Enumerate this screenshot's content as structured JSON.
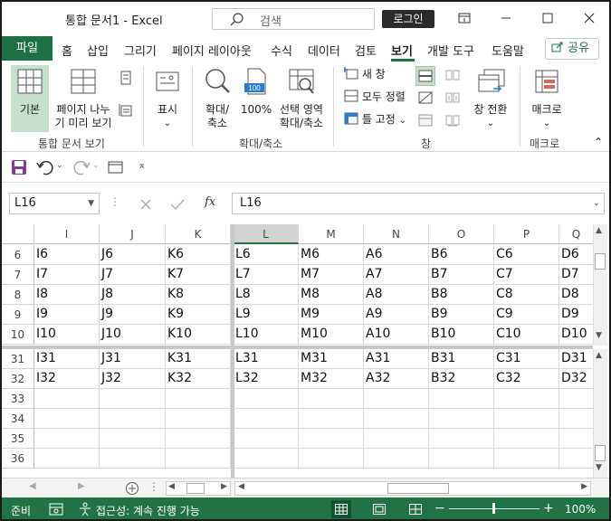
{
  "titlebar": {
    "title": "통합 문서1  -  Excel",
    "search_placeholder": "검색",
    "login_label": "로그인"
  },
  "tabs": {
    "file": "파일",
    "items": [
      "홈",
      "삽입",
      "그리기",
      "페이지 레이아웃",
      "수식",
      "데이터",
      "검토",
      "보기",
      "개발 도구",
      "도움말"
    ],
    "active": "보기",
    "share_label": "공유"
  },
  "ribbon": {
    "normal": "기본",
    "page_break_1": "페이지 나누",
    "page_break_2": "기 미리 보기",
    "group_views": "통합 문서 보기",
    "show": "표시",
    "zoom_1": "확대/",
    "zoom_2": "축소",
    "zoom100": "100%",
    "zoom100_icon": "100",
    "zoomsel_1": "선택 영역",
    "zoomsel_2": "확대/축소",
    "group_zoom": "확대/축소",
    "new_window": "새 창",
    "arrange_all": "모두 정렬",
    "freeze_panes": "틀 고정",
    "switch_windows": "창 전환",
    "group_window": "창",
    "macros": "매크로",
    "group_macros": "매크로"
  },
  "formula_bar": {
    "name_box": "L16",
    "content": "L16",
    "fx": "fx"
  },
  "grid": {
    "left_columns": [
      "I",
      "J",
      "K"
    ],
    "right_columns": [
      "L",
      "M",
      "N",
      "O",
      "P",
      "Q"
    ],
    "selected_column": "L",
    "top_rows": [
      {
        "row": "6",
        "cells": [
          "I6",
          "J6",
          "K6",
          "L6",
          "M6",
          "A6",
          "B6",
          "C6",
          "D6"
        ]
      },
      {
        "row": "7",
        "cells": [
          "I7",
          "J7",
          "K7",
          "L7",
          "M7",
          "A7",
          "B7",
          "C7",
          "D7"
        ]
      },
      {
        "row": "8",
        "cells": [
          "I8",
          "J8",
          "K8",
          "L8",
          "M8",
          "A8",
          "B8",
          "C8",
          "D8"
        ]
      },
      {
        "row": "9",
        "cells": [
          "I9",
          "J9",
          "K9",
          "L9",
          "M9",
          "A9",
          "B9",
          "C9",
          "D9"
        ]
      },
      {
        "row": "10",
        "cells": [
          "I10",
          "J10",
          "K10",
          "L10",
          "M10",
          "A10",
          "B10",
          "C10",
          "D10"
        ]
      }
    ],
    "bottom_rows": [
      {
        "row": "31",
        "cells": [
          "I31",
          "J31",
          "K31",
          "L31",
          "M31",
          "A31",
          "B31",
          "C31",
          "D31"
        ]
      },
      {
        "row": "32",
        "cells": [
          "I32",
          "J32",
          "K32",
          "L32",
          "M32",
          "A32",
          "B32",
          "C32",
          "D32"
        ]
      },
      {
        "row": "33",
        "cells": [
          "",
          "",
          "",
          "",
          "",
          "",
          "",
          "",
          ""
        ]
      },
      {
        "row": "34",
        "cells": [
          "",
          "",
          "",
          "",
          "",
          "",
          "",
          "",
          ""
        ]
      },
      {
        "row": "35",
        "cells": [
          "",
          "",
          "",
          "",
          "",
          "",
          "",
          "",
          ""
        ]
      },
      {
        "row": "36",
        "cells": [
          "",
          "",
          "",
          "",
          "",
          "",
          "",
          "",
          ""
        ]
      }
    ]
  },
  "status": {
    "ready": "준비",
    "accessibility": "접근성: 계속 진행 가능",
    "zoom": "100%"
  },
  "colors": {
    "accent": "#217346",
    "file_tab": "#1e7145"
  }
}
